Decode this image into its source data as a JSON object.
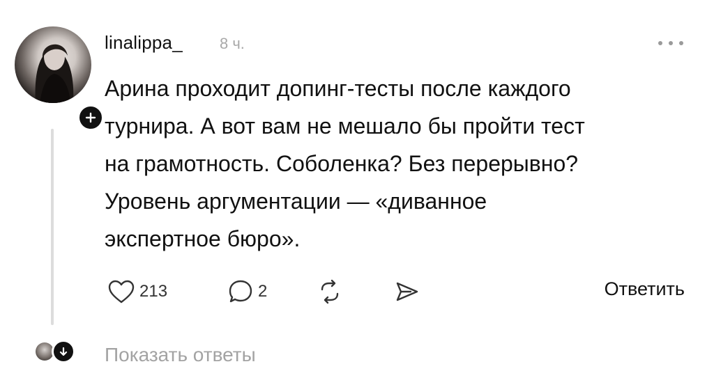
{
  "comment": {
    "author": {
      "username": "linalippa_",
      "avatar_icon": "avatar",
      "follow_icon": "plus-icon"
    },
    "time": "8 ч.",
    "more_icon": "more-horizontal-icon",
    "text_lines": [
      "Арина проходит допинг-тесты после каждого",
      "турнира. А вот вам не мешало бы пройти тест",
      "на грамотность. Соболенка? Без перерывно?",
      "Уровень аргументации — «диванное",
      "экспертное бюро»."
    ],
    "actions": {
      "likes": "213",
      "replies": "2",
      "like_icon": "heart-icon",
      "reply_icon": "comment-bubble-icon",
      "repost_icon": "repost-icon",
      "share_icon": "send-icon",
      "answer_label": "Ответить"
    }
  },
  "thread": {
    "show_replies_label": "Показать ответы",
    "expand_icon": "arrow-down-icon"
  },
  "colors": {
    "text": "#111111",
    "muted": "#a9a9a9",
    "thread_line": "#dcdcdc",
    "badge": "#111111"
  }
}
